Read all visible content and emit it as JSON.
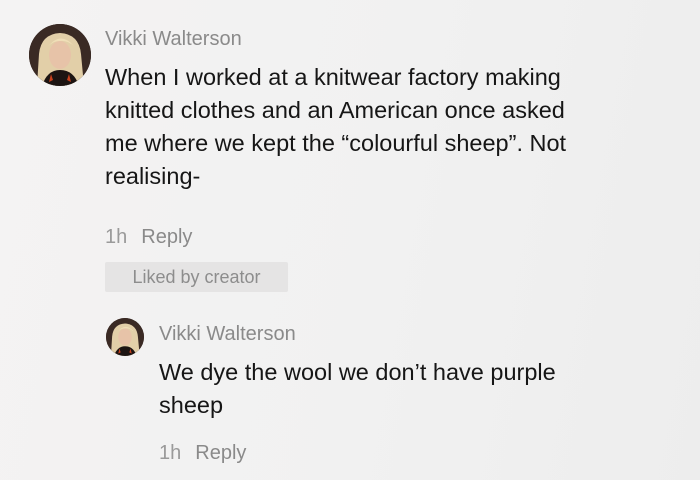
{
  "comment": {
    "author": "Vikki Walterson",
    "text_lines": [
      "When I worked at a knitwear factory making",
      "knitted clothes and an American once asked",
      "me where we kept the “colourful sheep”. Not",
      "realising-"
    ],
    "time": "1h",
    "reply_label": "Reply",
    "badge": "Liked by creator"
  },
  "reply_comment": {
    "author": "Vikki Walterson",
    "text_lines": [
      "We dye the wool we don’t have purple",
      "sheep"
    ],
    "time": "1h",
    "reply_label": "Reply"
  },
  "icons": {
    "avatar": "user-avatar-photo"
  },
  "colors": {
    "background": "#f2f2f2",
    "text": "#161616",
    "muted": "#8a8a8a",
    "badge_bg": "#e5e4e4"
  }
}
